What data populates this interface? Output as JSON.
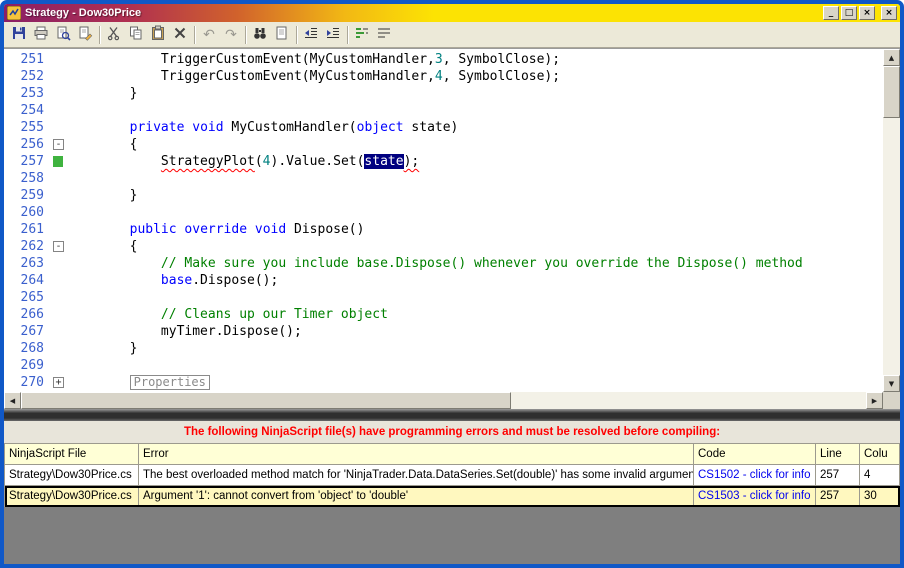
{
  "window": {
    "title": "Strategy - Dow30Price"
  },
  "glyphs": {
    "minimize": "_",
    "maximize": "□",
    "close": "×",
    "up": "▲",
    "down": "▼",
    "left": "◀",
    "right": "▶"
  },
  "colors": {
    "keyword": "#0000FF",
    "comment": "#008000",
    "number": "#008080",
    "selection_bg": "#000080",
    "line_number": "#3A5FCD",
    "error_text": "#FF0000",
    "link": "#0000EE",
    "title_left": "#8A1F66",
    "title_right": "#FCE303"
  },
  "toolbar": {
    "buttons": [
      {
        "name": "save",
        "icon": "floppy"
      },
      {
        "name": "print",
        "icon": "printer"
      },
      {
        "name": "print-preview",
        "icon": "preview"
      },
      {
        "name": "properties",
        "icon": "page_pencil"
      },
      {
        "sep": true
      },
      {
        "name": "cut",
        "icon": "scissors"
      },
      {
        "name": "copy",
        "icon": "copy"
      },
      {
        "name": "paste",
        "icon": "clipboard"
      },
      {
        "name": "delete",
        "icon": "delete_x"
      },
      {
        "sep": true
      },
      {
        "name": "undo",
        "glyph": "↶",
        "disabled": true
      },
      {
        "name": "redo",
        "glyph": "↷",
        "disabled": true
      },
      {
        "sep": true
      },
      {
        "name": "find",
        "icon": "binoculars"
      },
      {
        "name": "bookmarks",
        "icon": "page_star"
      },
      {
        "sep": true
      },
      {
        "name": "indent-decrease",
        "icon": "indent_dec"
      },
      {
        "name": "indent-increase",
        "icon": "indent_inc"
      },
      {
        "sep": true
      },
      {
        "name": "comment-selection",
        "icon": "comment_lines"
      },
      {
        "name": "uncomment-selection",
        "icon": "uncomment_lines"
      }
    ]
  },
  "editor": {
    "lines": [
      {
        "n": 251,
        "seg": [
          {
            "t": "            TriggerCustomEvent(MyCustomHandler,",
            "c": "p"
          },
          {
            "t": "3",
            "c": "n"
          },
          {
            "t": ", SymbolClose);",
            "c": "p"
          }
        ]
      },
      {
        "n": 252,
        "seg": [
          {
            "t": "            TriggerCustomEvent(MyCustomHandler,",
            "c": "p"
          },
          {
            "t": "4",
            "c": "n"
          },
          {
            "t": ", SymbolClose);",
            "c": "p"
          }
        ]
      },
      {
        "n": 253,
        "seg": [
          {
            "t": "        }",
            "c": "p"
          }
        ]
      },
      {
        "n": 254,
        "seg": []
      },
      {
        "n": 255,
        "seg": [
          {
            "t": "        ",
            "c": "p"
          },
          {
            "t": "private",
            "c": "k"
          },
          {
            "t": " ",
            "c": "p"
          },
          {
            "t": "void",
            "c": "k"
          },
          {
            "t": " MyCustomHandler(",
            "c": "p"
          },
          {
            "t": "object",
            "c": "k"
          },
          {
            "t": " state)",
            "c": "p"
          }
        ]
      },
      {
        "n": 256,
        "seg": [
          {
            "t": "        {",
            "c": "p"
          }
        ],
        "fold": "minus"
      },
      {
        "n": 257,
        "seg": [
          {
            "t": "            ",
            "c": "p"
          },
          {
            "t": "StrategyPlot",
            "c": "p sq"
          },
          {
            "t": "(",
            "c": "p"
          },
          {
            "t": "4",
            "c": "n"
          },
          {
            "t": ").Value.Set(",
            "c": "p"
          },
          {
            "t": "state",
            "c": "sel"
          },
          {
            "t": ");",
            "c": "p sq"
          }
        ],
        "green": true
      },
      {
        "n": 258,
        "seg": []
      },
      {
        "n": 259,
        "seg": [
          {
            "t": "        }",
            "c": "p"
          }
        ]
      },
      {
        "n": 260,
        "seg": []
      },
      {
        "n": 261,
        "seg": [
          {
            "t": "        ",
            "c": "p"
          },
          {
            "t": "public",
            "c": "k"
          },
          {
            "t": " ",
            "c": "p"
          },
          {
            "t": "override",
            "c": "k"
          },
          {
            "t": " ",
            "c": "p"
          },
          {
            "t": "void",
            "c": "k"
          },
          {
            "t": " Dispose()",
            "c": "p"
          }
        ]
      },
      {
        "n": 262,
        "seg": [
          {
            "t": "        {",
            "c": "p"
          }
        ],
        "fold": "minus"
      },
      {
        "n": 263,
        "seg": [
          {
            "t": "            ",
            "c": "p"
          },
          {
            "t": "// Make sure you include base.Dispose() whenever you override the Dispose() method",
            "c": "c"
          }
        ]
      },
      {
        "n": 264,
        "seg": [
          {
            "t": "            ",
            "c": "p"
          },
          {
            "t": "base",
            "c": "k"
          },
          {
            "t": ".Dispose();",
            "c": "p"
          }
        ]
      },
      {
        "n": 265,
        "seg": []
      },
      {
        "n": 266,
        "seg": [
          {
            "t": "            ",
            "c": "p"
          },
          {
            "t": "// Cleans up our Timer object",
            "c": "c"
          }
        ]
      },
      {
        "n": 267,
        "seg": [
          {
            "t": "            myTimer.Dispose();",
            "c": "p"
          }
        ]
      },
      {
        "n": 268,
        "seg": [
          {
            "t": "        }",
            "c": "p"
          }
        ]
      },
      {
        "n": 269,
        "seg": []
      },
      {
        "n": 270,
        "seg": [
          {
            "t": "        ",
            "c": "p"
          },
          {
            "t": "Properties",
            "c": "collapsed"
          }
        ],
        "fold": "plus"
      }
    ]
  },
  "errors": {
    "banner": "The following NinjaScript file(s) have programming errors and must be resolved before compiling:",
    "columns": [
      "NinjaScript File",
      "Error",
      "Code",
      "Line",
      "Colu"
    ],
    "rows": [
      {
        "file": "Strategy\\Dow30Price.cs",
        "error": "The best overloaded method match for 'NinjaTrader.Data.DataSeries.Set(double)' has some invalid arguments",
        "code": "CS1502 - click for info",
        "line": "257",
        "col": "4",
        "selected": false
      },
      {
        "file": "Strategy\\Dow30Price.cs",
        "error": "Argument '1': cannot convert from 'object' to 'double'",
        "code": "CS1503 - click for info",
        "line": "257",
        "col": "30",
        "selected": true
      }
    ]
  }
}
